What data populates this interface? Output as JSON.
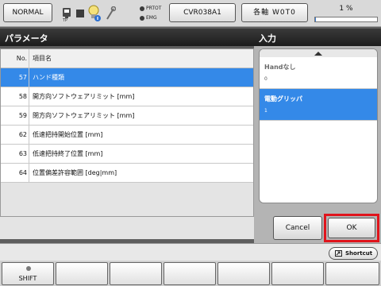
{
  "topbar": {
    "mode_label": "NORMAL",
    "tp_label": "TP",
    "lamp_prtot": "PRTOT",
    "lamp_emg": "EMG",
    "file_label": "CVR038A1",
    "axis_label": "各軸 W0T0",
    "speed_label": "1 %",
    "speed_fraction": 0.01
  },
  "param_panel": {
    "title": "パラメータ",
    "col_no": "No.",
    "col_name": "項目名",
    "rows": [
      {
        "no": "57",
        "name": "ハンド種類",
        "selected": true
      },
      {
        "no": "58",
        "name": "開方向ソフトウェアリミット [mm]",
        "selected": false
      },
      {
        "no": "59",
        "name": "閉方向ソフトウェアリミット [mm]",
        "selected": false
      },
      {
        "no": "62",
        "name": "低速把持開始位置 [mm]",
        "selected": false
      },
      {
        "no": "63",
        "name": "低速把持終了位置 [mm]",
        "selected": false
      },
      {
        "no": "64",
        "name": "位置偏差許容範囲 [deg|mm]",
        "selected": false
      }
    ]
  },
  "input_panel": {
    "title": "入力",
    "options": [
      {
        "label": "Handなし",
        "value": "0",
        "selected": false
      },
      {
        "label": "電動グリッパ",
        "value": "1",
        "selected": true
      }
    ],
    "cancel_label": "Cancel",
    "ok_label": "OK"
  },
  "bottom": {
    "shortcut_label": "Shortcut",
    "shift_label": "SHIFT"
  },
  "colors": {
    "selection": "#3489e8",
    "highlight_frame": "#e0141c",
    "header_dark": "#1c1c1c"
  }
}
